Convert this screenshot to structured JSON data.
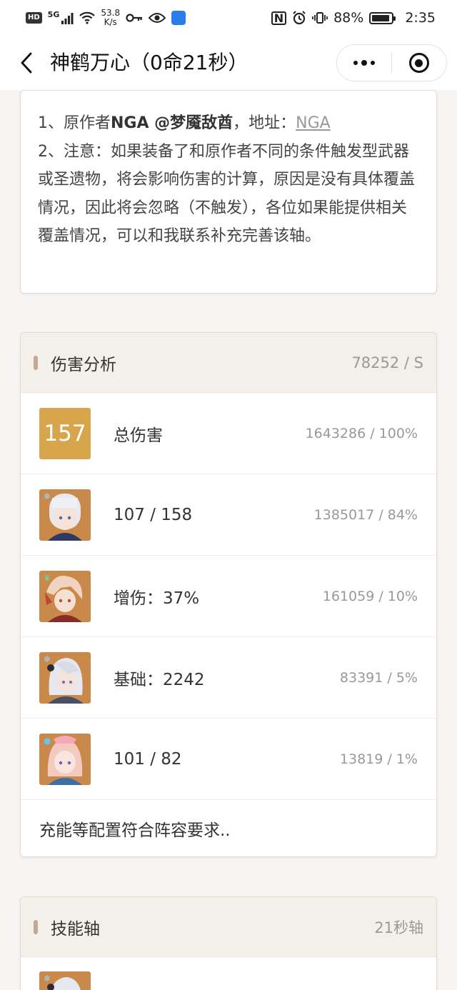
{
  "status_bar": {
    "hd": "HD",
    "network": "5G",
    "speed_top": "53.8",
    "speed_bottom": "K/s",
    "battery_text": "88%",
    "time": "2:35"
  },
  "nav": {
    "title": "神鹤万心（0命21秒）"
  },
  "notes": {
    "line1_prefix": "1、原作者",
    "line1_author": "NGA @梦魇敌酋",
    "line1_mid": "，地址：",
    "line1_link": "NGA",
    "line2": "2、注意：如果装备了和原作者不同的条件触发型武器或圣遗物，将会影响伤害的计算，原因是没有具体覆盖情况，因此将会忽略（不触发），各位如果能提供相关覆盖情况，可以和我联系补充完善该轴。"
  },
  "damage": {
    "title": "伤害分析",
    "dps": "78252 / S",
    "total": {
      "badge": "157",
      "label": "总伤害",
      "value": "1643286 / 100%"
    },
    "rows": [
      {
        "label": "107 / 158",
        "value": "1385017 / 84%"
      },
      {
        "label": "增伤：37%",
        "value": "161059 / 10%"
      },
      {
        "label": "基础：2242",
        "value": "83391 / 5%"
      },
      {
        "label": "101 / 82",
        "value": "13819 / 1%"
      }
    ],
    "footer": "充能等配置符合阵容要求.."
  },
  "skill": {
    "title": "技能轴",
    "right": "21秒轴"
  },
  "colors": {
    "accent": "#d6a54c",
    "section_bg": "#f3f0ea",
    "marker": "#c4a794"
  }
}
